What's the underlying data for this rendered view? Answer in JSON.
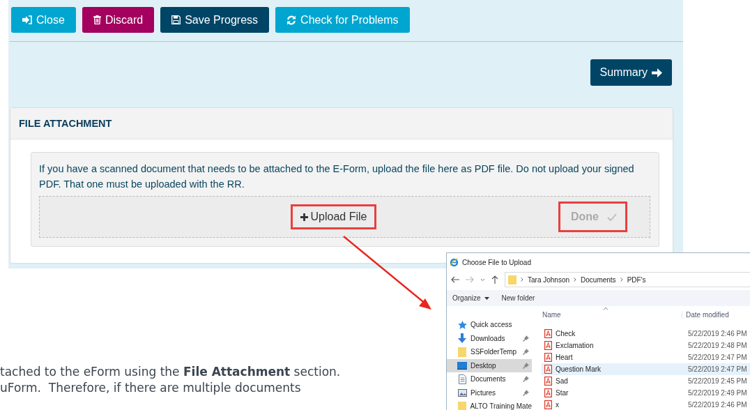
{
  "toolbar": [
    {
      "label": "Close",
      "kind": "close",
      "color": "#00a6cf"
    },
    {
      "label": "Discard",
      "kind": "discard",
      "color": "#a3005f"
    },
    {
      "label": "Save Progress",
      "kind": "save",
      "color": "#004566"
    },
    {
      "label": "Check for Problems",
      "kind": "check",
      "color": "#00a6cf"
    }
  ],
  "summary_button": {
    "label": "Summary"
  },
  "file_attachment": {
    "title": "FILE ATTACHMENT",
    "instructions": "If you have a scanned document that needs to be attached to the E-Form, upload the file here as PDF file. Do not upload your signed PDF. That one must be uploaded with the RR.",
    "upload_button": {
      "label": "Upload File"
    },
    "done_button": {
      "label": "Done",
      "disabled": true
    }
  },
  "dialog": {
    "title": "Choose File to Upload",
    "breadcrumb": [
      "Tara Johnson",
      "Documents",
      "PDF's"
    ],
    "commands": [
      {
        "label": "Organize",
        "kind": "menu"
      },
      {
        "label": "New folder",
        "kind": "plain"
      }
    ],
    "nav_items": [
      {
        "label": "Quick access",
        "kind": "star",
        "pinned": false,
        "selected": false
      },
      {
        "label": "Downloads",
        "kind": "download",
        "pinned": true,
        "selected": false
      },
      {
        "label": "SSFolderTemp",
        "kind": "folder",
        "pinned": true,
        "selected": false
      },
      {
        "label": "Desktop",
        "kind": "desktop",
        "pinned": true,
        "selected": true
      },
      {
        "label": "Documents",
        "kind": "documents",
        "pinned": true,
        "selected": false
      },
      {
        "label": "Pictures",
        "kind": "pictures",
        "pinned": true,
        "selected": false
      },
      {
        "label": "ALTO Training Mate",
        "kind": "folder",
        "pinned": false,
        "selected": false
      }
    ],
    "columns": [
      "Name",
      "Date modified"
    ],
    "files": [
      {
        "name": "Check",
        "date": "5/22/2019 2:46 PM",
        "selected": false
      },
      {
        "name": "Exclamation",
        "date": "5/22/2019 2:48 PM",
        "selected": false
      },
      {
        "name": "Heart",
        "date": "5/22/2019 2:47 PM",
        "selected": false
      },
      {
        "name": "Question Mark",
        "date": "5/22/2019 2:47 PM",
        "selected": true
      },
      {
        "name": "Sad",
        "date": "5/22/2019 2:45 PM",
        "selected": false
      },
      {
        "name": "Star",
        "date": "5/22/2019 2:49 PM",
        "selected": false
      },
      {
        "name": "x",
        "date": "5/22/2019 2:46 PM",
        "selected": false
      }
    ]
  },
  "document_text": [
    "tached to the eForm using the **File Attachment** section.",
    "uForm.  Therefore, if there are multiple documents"
  ]
}
